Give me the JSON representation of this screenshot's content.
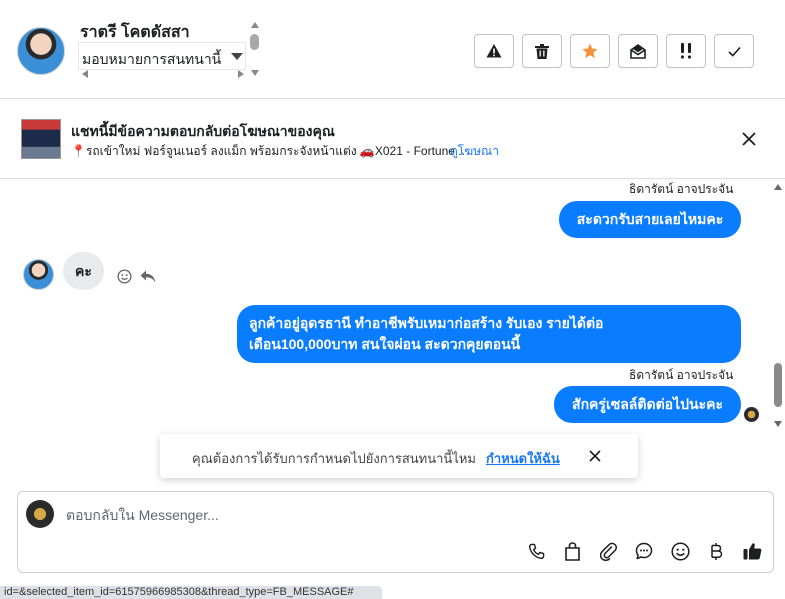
{
  "header": {
    "contact_name": "ราตรี โคตดัสสา",
    "assign_value": "มอบหมายการสนทนานี้",
    "actions": [
      {
        "name": "report-spam-button",
        "icon": "warning-icon"
      },
      {
        "name": "delete-button",
        "icon": "trash-icon"
      },
      {
        "name": "star-button",
        "icon": "star-icon"
      },
      {
        "name": "mark-unread-button",
        "icon": "open-envelope-icon"
      },
      {
        "name": "follow-up-button",
        "icon": "double-exclamation-icon"
      },
      {
        "name": "mark-done-button",
        "icon": "check-icon"
      }
    ],
    "star_color": "#f7923a"
  },
  "ad": {
    "title": "แชทนี้มีข้อความตอบกลับต่อโฆษณาของคุณ",
    "description": "📍รถเข้าใหม่ ฟอร์จูนเนอร์ ลงแม็ก พร้อมกระจังหน้าแต่ง 🚗X021 - Fortune...",
    "link": "ดูโฆษณา"
  },
  "messages": [
    {
      "direction": "out",
      "sender": "ธิดารัตน์ อาจประจัน",
      "text": "สะดวกรับสายเลยไหมคะ"
    },
    {
      "direction": "in",
      "text": "คะ"
    },
    {
      "direction": "out",
      "text_line1": "ลูกค้าอยู่อุดรธานี ทำอาชีพรับเหมาก่อสร้าง รับเอง รายได้ต่อ",
      "text_line2": "เดือน100,000บาท สนใจผ่อน สะดวกคุยตอนนี้"
    },
    {
      "direction": "out",
      "sender": "ธิดารัตน์ อาจประจัน",
      "text": "สักครู่เซลล์ติดต่อไปนะคะ"
    }
  ],
  "toast": {
    "text": "คุณต้องการได้รับการกำหนดไปยังการสนทนานี้ไหม",
    "link": "กำหนดให้ฉัน"
  },
  "composer": {
    "placeholder": "ตอบกลับใน Messenger...",
    "icons": [
      "phone-icon",
      "shopping-bag-icon",
      "paperclip-icon",
      "chat-bubble-icon",
      "smiley-icon",
      "baht-icon",
      "thumbs-up-icon"
    ]
  },
  "colors": {
    "bubble_out": "#0a7cff",
    "bubble_in": "#e9eaed",
    "link": "#1877f2"
  },
  "statusbar": "id=&selected_item_id=61575966985308&thread_type=FB_MESSAGE#"
}
